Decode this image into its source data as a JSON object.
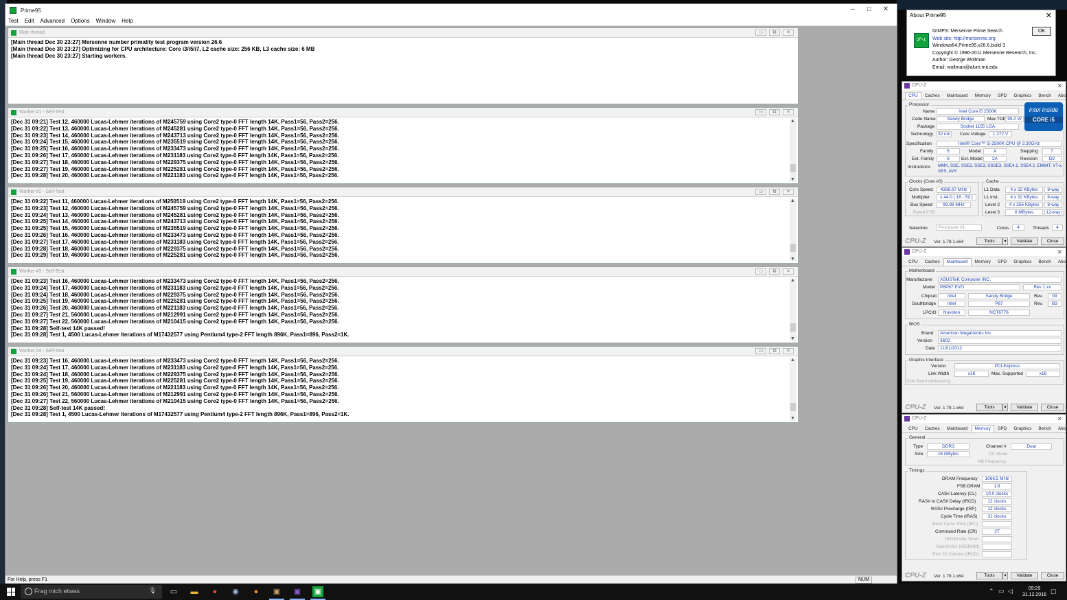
{
  "prime95": {
    "title": "Prime95",
    "menu": [
      "Test",
      "Edit",
      "Advanced",
      "Options",
      "Window",
      "Help"
    ],
    "status": "For Help, press F1",
    "num": "NUM",
    "windows": [
      {
        "title": "Main thread",
        "lines": [
          "[Main thread Dec 30 23:27] Mersenne number primality test program version 26.6",
          "[Main thread Dec 30 23:27] Optimizing for CPU architecture: Core i3/i5/i7, L2 cache size: 256 KB, L3 cache size: 6 MB",
          "[Main thread Dec 30 23:27] Starting workers."
        ]
      },
      {
        "title": "Worker #1 - Self-Test",
        "lines": [
          "[Dec 31 09:21] Test 12, 460000 Lucas-Lehmer iterations of M245759 using Core2 type-0 FFT length 14K, Pass1=56, Pass2=256.",
          "[Dec 31 09:22] Test 13, 460000 Lucas-Lehmer iterations of M245281 using Core2 type-0 FFT length 14K, Pass1=56, Pass2=256.",
          "[Dec 31 09:23] Test 14, 460000 Lucas-Lehmer iterations of M243713 using Core2 type-0 FFT length 14K, Pass1=56, Pass2=256.",
          "[Dec 31 09:24] Test 15, 460000 Lucas-Lehmer iterations of M235519 using Core2 type-0 FFT length 14K, Pass1=56, Pass2=256.",
          "[Dec 31 09:25] Test 16, 460000 Lucas-Lehmer iterations of M233473 using Core2 type-0 FFT length 14K, Pass1=56, Pass2=256.",
          "[Dec 31 09:26] Test 17, 460000 Lucas-Lehmer iterations of M231183 using Core2 type-0 FFT length 14K, Pass1=56, Pass2=256.",
          "[Dec 31 09:27] Test 18, 460000 Lucas-Lehmer iterations of M229375 using Core2 type-0 FFT length 14K, Pass1=56, Pass2=256.",
          "[Dec 31 09:27] Test 19, 460000 Lucas-Lehmer iterations of M225281 using Core2 type-0 FFT length 14K, Pass1=56, Pass2=256.",
          "[Dec 31 09:28] Test 20, 460000 Lucas-Lehmer iterations of M221183 using Core2 type-0 FFT length 14K, Pass1=56, Pass2=256."
        ]
      },
      {
        "title": "Worker #2 - Self-Test",
        "lines": [
          "[Dec 31 09:22] Test 11, 460000 Lucas-Lehmer iterations of M250519 using Core2 type-0 FFT length 14K, Pass1=56, Pass2=256.",
          "[Dec 31 09:23] Test 12, 460000 Lucas-Lehmer iterations of M245759 using Core2 type-0 FFT length 14K, Pass1=56, Pass2=256.",
          "[Dec 31 09:24] Test 13, 460000 Lucas-Lehmer iterations of M245281 using Core2 type-0 FFT length 14K, Pass1=56, Pass2=256.",
          "[Dec 31 09:25] Test 14, 460000 Lucas-Lehmer iterations of M243713 using Core2 type-0 FFT length 14K, Pass1=56, Pass2=256.",
          "[Dec 31 09:25] Test 15, 460000 Lucas-Lehmer iterations of M235519 using Core2 type-0 FFT length 14K, Pass1=56, Pass2=256.",
          "[Dec 31 09:26] Test 16, 460000 Lucas-Lehmer iterations of M233473 using Core2 type-0 FFT length 14K, Pass1=56, Pass2=256.",
          "[Dec 31 09:27] Test 17, 460000 Lucas-Lehmer iterations of M231183 using Core2 type-0 FFT length 14K, Pass1=56, Pass2=256.",
          "[Dec 31 09:28] Test 18, 460000 Lucas-Lehmer iterations of M229375 using Core2 type-0 FFT length 14K, Pass1=56, Pass2=256.",
          "[Dec 31 09:29] Test 19, 460000 Lucas-Lehmer iterations of M225281 using Core2 type-0 FFT length 14K, Pass1=56, Pass2=256."
        ]
      },
      {
        "title": "Worker #3 - Self-Test",
        "lines": [
          "[Dec 31 09:23] Test 16, 460000 Lucas-Lehmer iterations of M233473 using Core2 type-0 FFT length 14K, Pass1=56, Pass2=256.",
          "[Dec 31 09:24] Test 17, 460000 Lucas-Lehmer iterations of M231183 using Core2 type-0 FFT length 14K, Pass1=56, Pass2=256.",
          "[Dec 31 09:24] Test 18, 460000 Lucas-Lehmer iterations of M229375 using Core2 type-0 FFT length 14K, Pass1=56, Pass2=256.",
          "[Dec 31 09:25] Test 19, 460000 Lucas-Lehmer iterations of M225281 using Core2 type-0 FFT length 14K, Pass1=56, Pass2=256.",
          "[Dec 31 09:26] Test 20, 460000 Lucas-Lehmer iterations of M221183 using Core2 type-0 FFT length 14K, Pass1=56, Pass2=256.",
          "[Dec 31 09:27] Test 21, 560000 Lucas-Lehmer iterations of M212991 using Core2 type-0 FFT length 14K, Pass1=56, Pass2=256.",
          "[Dec 31 09:27] Test 22, 560000 Lucas-Lehmer iterations of M210415 using Core2 type-0 FFT length 14K, Pass1=56, Pass2=256.",
          "[Dec 31 09:28] Self-test 14K passed!",
          "[Dec 31 09:28] Test 1, 4500 Lucas-Lehmer iterations of M17432577 using Pentium4 type-2 FFT length 896K, Pass1=896, Pass2=1K."
        ]
      },
      {
        "title": "Worker #4 - Self-Test",
        "lines": [
          "[Dec 31 09:23] Test 16, 460000 Lucas-Lehmer iterations of M233473 using Core2 type-0 FFT length 14K, Pass1=56, Pass2=256.",
          "[Dec 31 09:24] Test 17, 460000 Lucas-Lehmer iterations of M231183 using Core2 type-0 FFT length 14K, Pass1=56, Pass2=256.",
          "[Dec 31 09:24] Test 18, 460000 Lucas-Lehmer iterations of M229375 using Core2 type-0 FFT length 14K, Pass1=56, Pass2=256.",
          "[Dec 31 09:25] Test 19, 460000 Lucas-Lehmer iterations of M225281 using Core2 type-0 FFT length 14K, Pass1=56, Pass2=256.",
          "[Dec 31 09:26] Test 20, 460000 Lucas-Lehmer iterations of M221183 using Core2 type-0 FFT length 14K, Pass1=56, Pass2=256.",
          "[Dec 31 09:26] Test 21, 560000 Lucas-Lehmer iterations of M212991 using Core2 type-0 FFT length 14K, Pass1=56, Pass2=256.",
          "[Dec 31 09:27] Test 22, 560000 Lucas-Lehmer iterations of M210415 using Core2 type-0 FFT length 14K, Pass1=56, Pass2=256.",
          "[Dec 31 09:28] Self-test 14K passed!",
          "[Dec 31 09:28] Test 1, 4500 Lucas-Lehmer iterations of M17432577 using Pentium4 type-2 FFT length 896K, Pass1=896, Pass2=1K."
        ]
      }
    ]
  },
  "about": {
    "title": "About Prime95",
    "ok": "OK",
    "lines": [
      "GIMPS: Mersenne Prime Search",
      "Web site: http://mersenne.org",
      "Windows64,Prime95,v26.6,build 3",
      "Copyright © 1996-2011 Mersenne Research, Inc.",
      "Author: George Woltman",
      "Email: woltman@alum.mit.edu"
    ]
  },
  "cpuz": {
    "title": "CPU-Z",
    "tabs": [
      "CPU",
      "Caches",
      "Mainboard",
      "Memory",
      "SPD",
      "Graphics",
      "Bench",
      "About"
    ],
    "version": "Ver. 1.78.1.x64",
    "logo": "CPU-Z",
    "tools": "Tools",
    "validate": "Validate",
    "close": "Close",
    "cpu": {
      "processor_label": "Processor",
      "name_l": "Name",
      "name": "Intel Core i5 2500K",
      "codename_l": "Code Name",
      "codename": "Sandy Bridge",
      "maxtdp_l": "Max TDP",
      "maxtdp": "95.0 W",
      "package_l": "Package",
      "package": "Socket 1155 LGA",
      "tech_l": "Technology",
      "tech": "32 nm",
      "corev_l": "Core Voltage",
      "corev": "1.272 V",
      "spec_l": "Specification",
      "spec": "Intel® Core™ i5-2500K CPU @ 3.30GHz",
      "family_l": "Family",
      "family": "6",
      "model_l": "Model",
      "model": "A",
      "stepping_l": "Stepping",
      "stepping": "7",
      "extfam_l": "Ext. Family",
      "extfam": "6",
      "extmodel_l": "Ext. Model",
      "extmodel": "2A",
      "revision_l": "Revision",
      "revision": "D2",
      "instr_l": "Instructions",
      "instr": "MMX, SSE, SSE2, SSE3, SSSE3, SSE4.1, SSE4.2, EM64T, VT-x, AES, AVX",
      "clocks_label": "Clocks (Core #0)",
      "corespeed_l": "Core Speed",
      "corespeed": "4398.97 MHz",
      "mult_l": "Multiplier",
      "mult": "x 44.0 ( 16 - 59 )",
      "bus_l": "Bus Speed",
      "bus": "99.98 MHz",
      "fsb_l": "Rated FSB",
      "cache_label": "Cache",
      "l1d_l": "L1 Data",
      "l1d": "4 x 32 KBytes",
      "l1d_w": "8-way",
      "l1i_l": "L1 Inst.",
      "l1i": "4 x 32 KBytes",
      "l1i_w": "8-way",
      "l2_l": "Level 2",
      "l2": "4 x 256 KBytes",
      "l2_w": "8-way",
      "l3_l": "Level 3",
      "l3": "6 MBytes",
      "l3_w": "12-way",
      "sel_l": "Selection",
      "sel": "Processor #1",
      "cores_l": "Cores",
      "cores": "4",
      "threads_l": "Threads",
      "threads": "4",
      "intel_a": "intel inside",
      "intel_b": "CORE i5"
    },
    "mb": {
      "motherboard_label": "Motherboard",
      "manu_l": "Manufacturer",
      "manu": "ASUSTeK Computer INC.",
      "model_l": "Model",
      "model": "P8P67 EVO",
      "rev": "Rev 1.xx",
      "chipset_l": "Chipset",
      "chipset_a": "Intel",
      "chipset_b": "Sandy Bridge",
      "chipset_rev_l": "Rev.",
      "chipset_rev": "09",
      "south_l": "Southbridge",
      "south_a": "Intel",
      "south_b": "P67",
      "south_rev_l": "Rev.",
      "south_rev": "B3",
      "lpcio_l": "LPCIO",
      "lpcio_a": "Nuvoton",
      "lpcio_b": "NCT6776",
      "bios_label": "BIOS",
      "brand_l": "Brand",
      "brand": "American Megatrends Inc.",
      "version_l": "Version",
      "version": "3602",
      "date_l": "Date",
      "date": "11/01/2012",
      "gi_label": "Graphic Interface",
      "giver_l": "Version",
      "giver": "PCI-Express",
      "lw_l": "Link Width",
      "lw": "x16",
      "ms_l": "Max. Supported",
      "ms": "x16",
      "sba_l": "Side Band Addressing"
    },
    "mem": {
      "general_label": "General",
      "type_l": "Type",
      "type": "DDR3",
      "chan_l": "Channel #",
      "chan": "Dual",
      "size_l": "Size",
      "size": "16 GBytes",
      "dc_l": "DC Mode",
      "nb_l": "NB Frequency",
      "timings_label": "Timings",
      "dram_l": "DRAM Frequency",
      "dram": "1066.5 MHz",
      "fsbdram_l": "FSB:DRAM",
      "fsbdram": "1:8",
      "cl_l": "CAS# Latency (CL)",
      "cl": "10.0 clocks",
      "trcd_l": "RAS# to CAS# Delay (tRCD)",
      "trcd": "12 clocks",
      "trp_l": "RAS# Precharge (tRP)",
      "trp": "12 clocks",
      "tras_l": "Cycle Time (tRAS)",
      "tras": "31 clocks",
      "trc_l": "Bank Cycle Time (tRC)",
      "cr_l": "Command Rate (CR)",
      "cr": "2T",
      "idle_l": "DRAM Idle Timer",
      "trdram_l": "Total CAS# (tRDRAM)",
      "trcd2_l": "Row To Column (tRCD)"
    }
  },
  "taskbar": {
    "search": "Frag mich etwas",
    "time": "09:29",
    "date": "31.12.2016"
  }
}
